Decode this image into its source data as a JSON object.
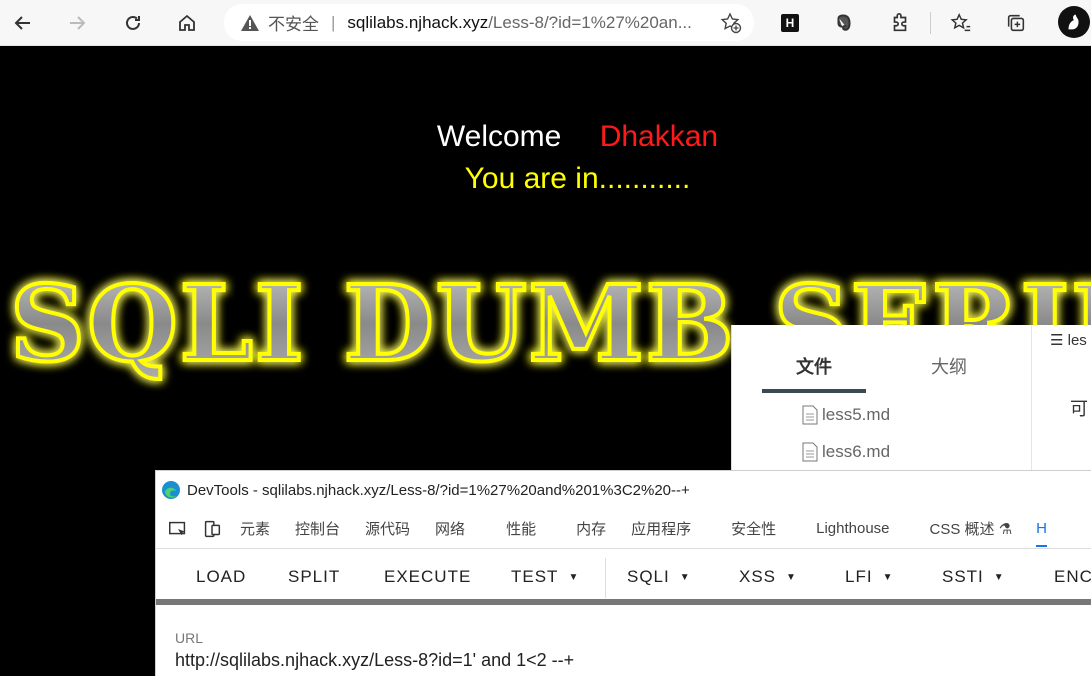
{
  "browser": {
    "insecure_label": "不安全",
    "separator": "|",
    "url_host": "sqlilabs.njhack.xyz",
    "url_path": "/Less-8/?id=1%27%20an...",
    "extensions": [
      "H"
    ]
  },
  "page": {
    "welcome": "Welcome",
    "user": "Dhakkan",
    "status": "You are in...........",
    "banner_text": "SQLI DUMB SERIES",
    "banner_colors": {
      "glow": "#ffff00",
      "fill": "#9a9a9a"
    }
  },
  "typora": {
    "tab_files": "文件",
    "tab_outline": "大纲",
    "files": [
      "less5.md",
      "less6.md"
    ],
    "right_top": "les",
    "right_char": "可"
  },
  "devtools": {
    "title": "DevTools - sqlilabs.njhack.xyz/Less-8/?id=1%27%20and%201%3C2%20--+",
    "tabs": [
      "元素",
      "控制台",
      "源代码",
      "网络",
      "性能",
      "内存",
      "应用程序",
      "安全性",
      "Lighthouse",
      "CSS 概述 ⚗",
      "H"
    ],
    "hackbar": {
      "buttons": [
        "LOAD",
        "SPLIT",
        "EXECUTE",
        "TEST",
        "SQLI",
        "XSS",
        "LFI",
        "SSTI",
        "ENC"
      ],
      "url_label": "URL",
      "url_value": "http://sqlilabs.njhack.xyz/Less-8?id=1' and 1<2 --+"
    }
  }
}
